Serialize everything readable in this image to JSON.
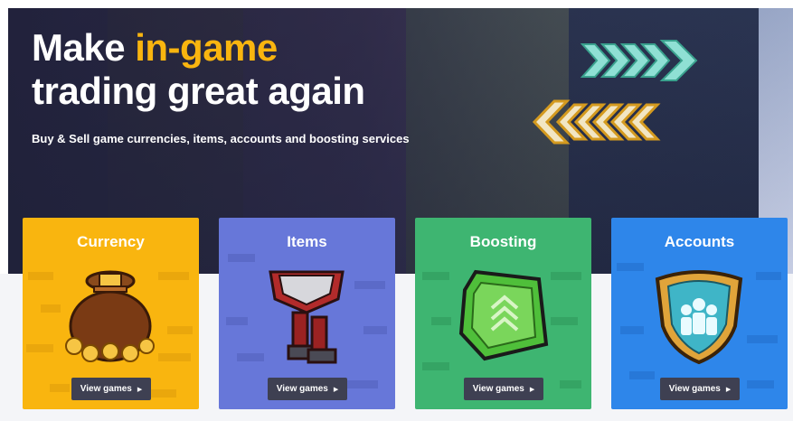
{
  "hero": {
    "headline_line1_prefix": "Make ",
    "headline_line1_accent": "in-game",
    "headline_line2": "trading great again",
    "subline": "Buy & Sell game currencies, items, accounts and boosting services"
  },
  "colors": {
    "accent": "#f9b50f",
    "currency": "#f9b50f",
    "items": "#6777d9",
    "boosting": "#3eb571",
    "accounts": "#2e86ea",
    "button": "#3e4052"
  },
  "cards": [
    {
      "title": "Currency",
      "button_label": "View games",
      "icon": "gold-bag-icon"
    },
    {
      "title": "Items",
      "button_label": "View games",
      "icon": "armor-icon"
    },
    {
      "title": "Boosting",
      "button_label": "View games",
      "icon": "green-gem-icon"
    },
    {
      "title": "Accounts",
      "button_label": "View games",
      "icon": "shield-icon"
    }
  ]
}
